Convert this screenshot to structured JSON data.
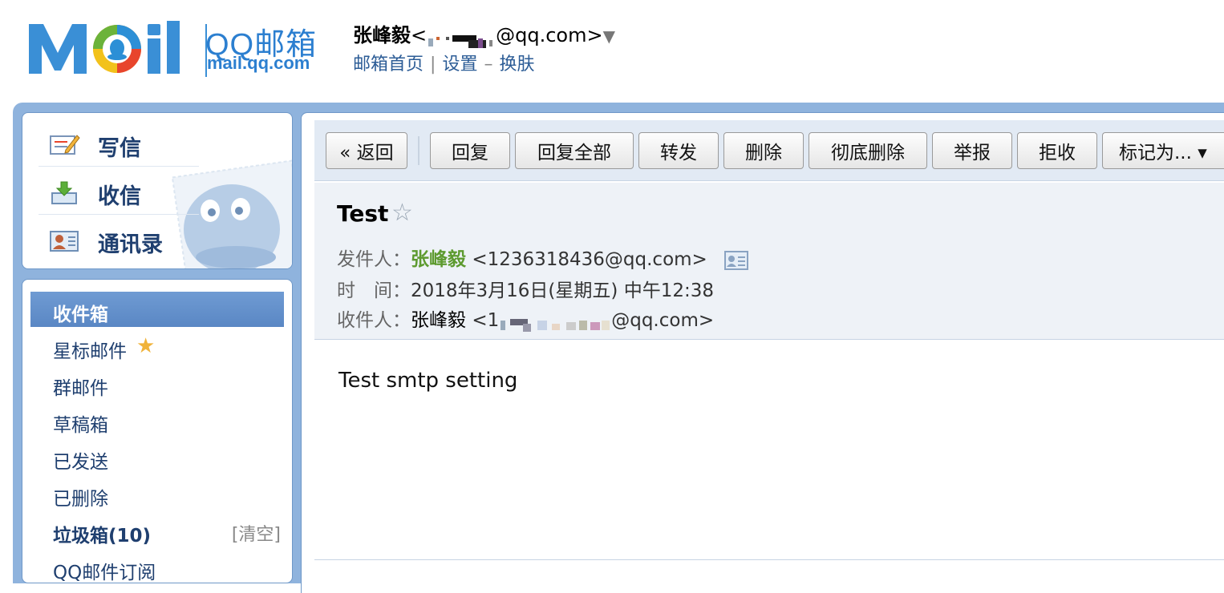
{
  "logo": {
    "brand": "QQ邮箱",
    "domain": "mail.qq.com"
  },
  "account": {
    "name": "张峰毅",
    "open": "<",
    "suffix": "@qq.com>",
    "dropdown": "▼"
  },
  "top_links": {
    "home": "邮箱首页",
    "divider": "|",
    "settings": "设置",
    "dash": "–",
    "skin": "换肤"
  },
  "quick_actions": [
    {
      "label": "写信",
      "icon": "compose-icon"
    },
    {
      "label": "收信",
      "icon": "inbox-download-icon"
    },
    {
      "label": "通讯录",
      "icon": "contacts-icon"
    }
  ],
  "folders": [
    {
      "label": "收件箱",
      "active": true
    },
    {
      "label": "星标邮件",
      "star": "★"
    },
    {
      "label": "群邮件"
    },
    {
      "label": "草稿箱"
    },
    {
      "label": "已发送"
    },
    {
      "label": "已删除"
    },
    {
      "label": "垃圾箱(10)",
      "action": "[清空]"
    },
    {
      "label": "QQ邮件订阅"
    }
  ],
  "toolbar": {
    "back": "« 返回",
    "reply": "回复",
    "reply_all": "回复全部",
    "forward": "转发",
    "delete": "删除",
    "delete_permanently": "彻底删除",
    "report": "举报",
    "reject": "拒收",
    "mark_as": "标记为... ▾"
  },
  "mail": {
    "subject": "Test",
    "star": "☆",
    "from_label": "发件人：",
    "from_name": "张峰毅",
    "from_addr": "<1236318436@qq.com>",
    "time_label": "时　间：",
    "time_value": "2018年3月16日(星期五) 中午12:38",
    "to_label": "收件人：",
    "to_name": "张峰毅",
    "to_addr_open": "<1",
    "to_addr_close": "@qq.com>",
    "body": "Test smtp setting"
  },
  "colors": {
    "accent": "#2c7fd0",
    "frame": "#8fb3dd",
    "active_folder": "#5a87c4",
    "sender": "#5d9a2f"
  }
}
